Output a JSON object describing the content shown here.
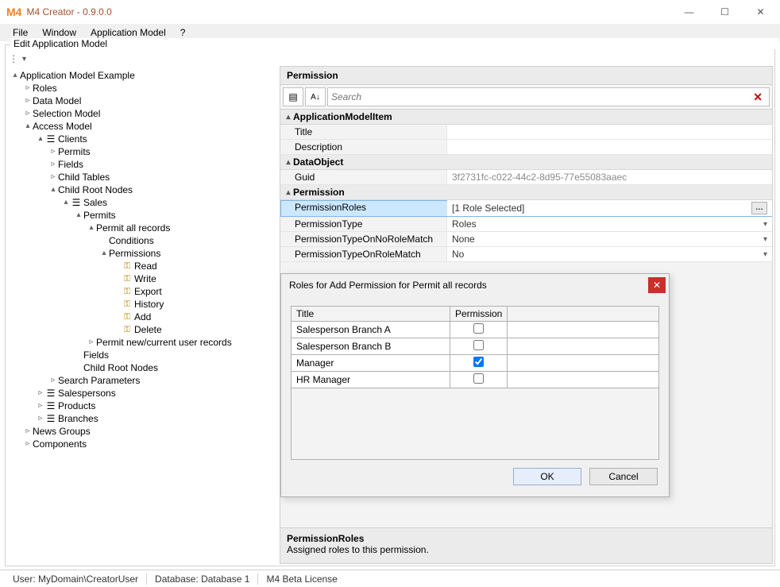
{
  "window": {
    "title": "M4 Creator - 0.9.0.0",
    "logo": "M4"
  },
  "winbtns": {
    "min": "—",
    "max": "☐",
    "close": "✕"
  },
  "menu": {
    "file": "File",
    "window": "Window",
    "appmodel": "Application Model",
    "help": "?"
  },
  "groupbox": {
    "label": "Edit Application Model"
  },
  "tree": {
    "root": "Application Model Example",
    "roles": "Roles",
    "datamodel": "Data Model",
    "selmodel": "Selection Model",
    "access": "Access Model",
    "clients": "Clients",
    "permits": "Permits",
    "fields": "Fields",
    "childtables": "Child Tables",
    "childroot": "Child Root Nodes",
    "sales": "Sales",
    "permits2": "Permits",
    "permitall": "Permit all records",
    "conditions": "Conditions",
    "permissions": "Permissions",
    "read": "Read",
    "write": "Write",
    "export": "Export",
    "history": "History",
    "add": "Add",
    "delete": "Delete",
    "permitnew": "Permit new/current user records",
    "fields2": "Fields",
    "childroot2": "Child Root Nodes",
    "searchparams": "Search Parameters",
    "salespersons": "Salespersons",
    "products": "Products",
    "branches": "Branches",
    "newsgroups": "News Groups",
    "components": "Components"
  },
  "perm": {
    "header": "Permission",
    "search_placeholder": "Search",
    "cat1": "ApplicationModelItem",
    "title": "Title",
    "title_v": "",
    "desc": "Description",
    "desc_v": "",
    "cat2": "DataObject",
    "guid": "Guid",
    "guid_v": "3f2731fc-c022-44c2-8d95-77e55083aaec",
    "cat3": "Permission",
    "proles": "PermissionRoles",
    "proles_v": "[1 Role Selected]",
    "ptype": "PermissionType",
    "ptype_v": "Roles",
    "pno": "PermissionTypeOnNoRoleMatch",
    "pno_v": "None",
    "pon": "PermissionTypeOnRoleMatch",
    "pon_v": "No",
    "help_t": "PermissionRoles",
    "help_d": "Assigned roles to this permission."
  },
  "dialog": {
    "title": "Roles for Add Permission for Permit all records",
    "col_title": "Title",
    "col_perm": "Permission",
    "rows": [
      "Salesperson Branch A",
      "Salesperson Branch B",
      "Manager",
      "HR Manager"
    ],
    "ok": "OK",
    "cancel": "Cancel"
  },
  "status": {
    "user": "User: MyDomain\\CreatorUser",
    "db": "Database: Database 1",
    "lic": "M4 Beta License"
  }
}
